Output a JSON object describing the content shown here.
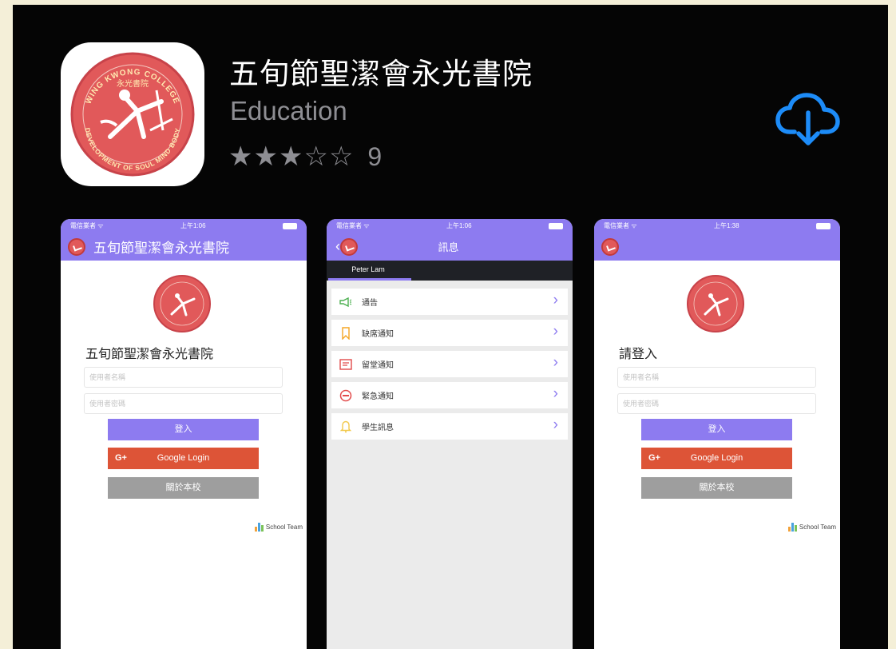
{
  "app": {
    "name": "五旬節聖潔會永光書院",
    "category": "Education",
    "rating_stars": 3,
    "rating_max": 5,
    "rating_count": "9",
    "icon_logo_text_top": "WING KWONG COLLEGE",
    "icon_logo_text_chinese": "永光書院",
    "icon_logo_text_bottom": "DEVELOPMENT OF SOUL MIND BODY"
  },
  "screens": {
    "login_school": {
      "carrier": "電信業者 ᯤ",
      "time": "上午1:06",
      "header_title": "五旬節聖潔會永光書院",
      "form_title": "五旬節聖潔會永光書院",
      "username_placeholder": "使用者名稱",
      "password_placeholder": "使用者密碼",
      "login_label": "登入",
      "google_label": "Google Login",
      "google_mark": "G+",
      "about_label": "關於本校",
      "brand": "School Team"
    },
    "messages": {
      "carrier": "電信業者 ᯤ",
      "time": "上午1:06",
      "header_title": "訊息",
      "tab_label": "Peter Lam",
      "items": [
        {
          "label": "通告",
          "icon": "megaphone-icon"
        },
        {
          "label": "缺席通知",
          "icon": "bookmark-icon"
        },
        {
          "label": "留堂通知",
          "icon": "notice-card-icon"
        },
        {
          "label": "緊急通知",
          "icon": "no-entry-icon"
        },
        {
          "label": "學生訊息",
          "icon": "bell-icon"
        }
      ]
    },
    "login_generic": {
      "carrier": "電信業者 ᯤ",
      "time": "上午1:38",
      "form_title": "請登入",
      "username_placeholder": "使用者名稱",
      "password_placeholder": "使用者密碼",
      "login_label": "登入",
      "google_label": "Google Login",
      "google_mark": "G+",
      "about_label": "關於本校",
      "brand": "School Team"
    }
  },
  "colors": {
    "background": "#050505",
    "accent": "#8d7bf0",
    "google": "#dd5437",
    "download": "#1d8cf8",
    "logo_red": "#e1595a"
  }
}
